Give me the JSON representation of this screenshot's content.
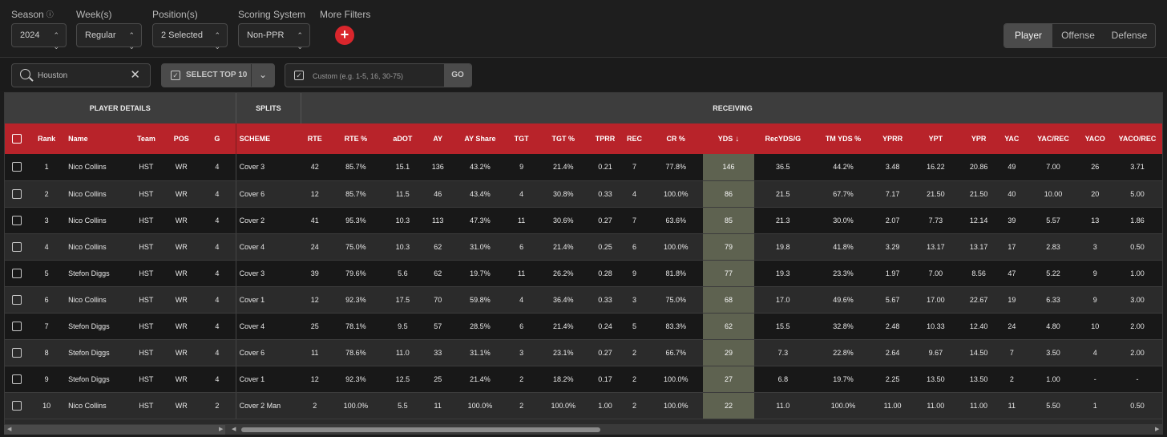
{
  "filters": {
    "season": {
      "label": "Season",
      "value": "2024"
    },
    "weeks": {
      "label": "Week(s)",
      "value": "Regular"
    },
    "positions": {
      "label": "Position(s)",
      "value": "2 Selected"
    },
    "scoring": {
      "label": "Scoring System",
      "value": "Non-PPR"
    },
    "more": {
      "label": "More Filters",
      "add": "+"
    }
  },
  "view_toggle": {
    "player": "Player",
    "offense": "Offense",
    "defense": "Defense"
  },
  "toolbar": {
    "search_value": "Houston",
    "select_top_label": "SELECT TOP 10",
    "custom_placeholder": "Custom (e.g. 1-5, 16, 30-75)",
    "go_label": "GO"
  },
  "groups": {
    "player_details": "PLAYER DETAILS",
    "splits": "SPLITS",
    "receiving": "RECEIVING"
  },
  "columns": [
    "Rank",
    "Name",
    "Team",
    "POS",
    "G",
    "SCHEME",
    "RTE",
    "RTE %",
    "aDOT",
    "AY",
    "AY Share",
    "TGT",
    "TGT %",
    "TPRR",
    "REC",
    "CR %",
    "YDS",
    "RecYDS/G",
    "TM YDS %",
    "YPRR",
    "YPT",
    "YPR",
    "YAC",
    "YAC/REC",
    "YACO",
    "YACO/REC"
  ],
  "sort_icon": "↓",
  "rows": [
    [
      "1",
      "Nico Collins",
      "HST",
      "WR",
      "4",
      "Cover 3",
      "42",
      "85.7%",
      "15.1",
      "136",
      "43.2%",
      "9",
      "21.4%",
      "0.21",
      "7",
      "77.8%",
      "146",
      "36.5",
      "44.2%",
      "3.48",
      "16.22",
      "20.86",
      "49",
      "7.00",
      "26",
      "3.71"
    ],
    [
      "2",
      "Nico Collins",
      "HST",
      "WR",
      "4",
      "Cover 6",
      "12",
      "85.7%",
      "11.5",
      "46",
      "43.4%",
      "4",
      "30.8%",
      "0.33",
      "4",
      "100.0%",
      "86",
      "21.5",
      "67.7%",
      "7.17",
      "21.50",
      "21.50",
      "40",
      "10.00",
      "20",
      "5.00"
    ],
    [
      "3",
      "Nico Collins",
      "HST",
      "WR",
      "4",
      "Cover 2",
      "41",
      "95.3%",
      "10.3",
      "113",
      "47.3%",
      "11",
      "30.6%",
      "0.27",
      "7",
      "63.6%",
      "85",
      "21.3",
      "30.0%",
      "2.07",
      "7.73",
      "12.14",
      "39",
      "5.57",
      "13",
      "1.86"
    ],
    [
      "4",
      "Nico Collins",
      "HST",
      "WR",
      "4",
      "Cover 4",
      "24",
      "75.0%",
      "10.3",
      "62",
      "31.0%",
      "6",
      "21.4%",
      "0.25",
      "6",
      "100.0%",
      "79",
      "19.8",
      "41.8%",
      "3.29",
      "13.17",
      "13.17",
      "17",
      "2.83",
      "3",
      "0.50"
    ],
    [
      "5",
      "Stefon Diggs",
      "HST",
      "WR",
      "4",
      "Cover 3",
      "39",
      "79.6%",
      "5.6",
      "62",
      "19.7%",
      "11",
      "26.2%",
      "0.28",
      "9",
      "81.8%",
      "77",
      "19.3",
      "23.3%",
      "1.97",
      "7.00",
      "8.56",
      "47",
      "5.22",
      "9",
      "1.00"
    ],
    [
      "6",
      "Nico Collins",
      "HST",
      "WR",
      "4",
      "Cover 1",
      "12",
      "92.3%",
      "17.5",
      "70",
      "59.8%",
      "4",
      "36.4%",
      "0.33",
      "3",
      "75.0%",
      "68",
      "17.0",
      "49.6%",
      "5.67",
      "17.00",
      "22.67",
      "19",
      "6.33",
      "9",
      "3.00"
    ],
    [
      "7",
      "Stefon Diggs",
      "HST",
      "WR",
      "4",
      "Cover 4",
      "25",
      "78.1%",
      "9.5",
      "57",
      "28.5%",
      "6",
      "21.4%",
      "0.24",
      "5",
      "83.3%",
      "62",
      "15.5",
      "32.8%",
      "2.48",
      "10.33",
      "12.40",
      "24",
      "4.80",
      "10",
      "2.00"
    ],
    [
      "8",
      "Stefon Diggs",
      "HST",
      "WR",
      "4",
      "Cover 6",
      "11",
      "78.6%",
      "11.0",
      "33",
      "31.1%",
      "3",
      "23.1%",
      "0.27",
      "2",
      "66.7%",
      "29",
      "7.3",
      "22.8%",
      "2.64",
      "9.67",
      "14.50",
      "7",
      "3.50",
      "4",
      "2.00"
    ],
    [
      "9",
      "Stefon Diggs",
      "HST",
      "WR",
      "4",
      "Cover 1",
      "12",
      "92.3%",
      "12.5",
      "25",
      "21.4%",
      "2",
      "18.2%",
      "0.17",
      "2",
      "100.0%",
      "27",
      "6.8",
      "19.7%",
      "2.25",
      "13.50",
      "13.50",
      "2",
      "1.00",
      "-",
      "-"
    ],
    [
      "10",
      "Nico Collins",
      "HST",
      "WR",
      "2",
      "Cover 2 Man",
      "2",
      "100.0%",
      "5.5",
      "11",
      "100.0%",
      "2",
      "100.0%",
      "1.00",
      "2",
      "100.0%",
      "22",
      "11.0",
      "100.0%",
      "11.00",
      "11.00",
      "11.00",
      "11",
      "5.50",
      "1",
      "0.50"
    ]
  ]
}
